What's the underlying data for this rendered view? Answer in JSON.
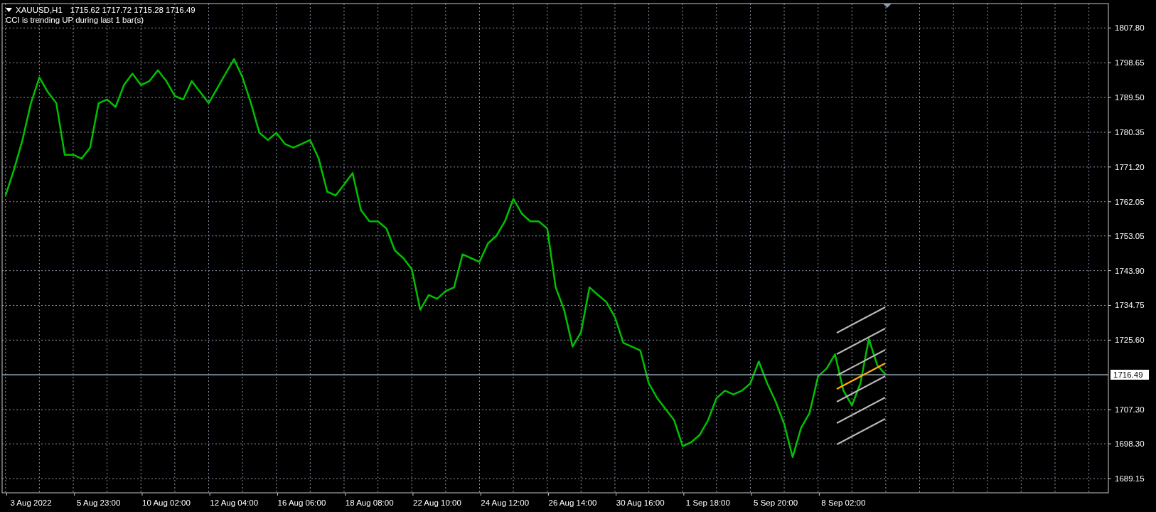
{
  "header": {
    "quotes": "1715.62 1717.72 1715.28 1716.49",
    "message": "CCI is trending UP during last 1 bar(s)"
  },
  "current_price": {
    "label": "1716.49"
  },
  "chart_data": {
    "type": "line",
    "grid": true,
    "ylim": [
      1685.4,
      1814.24
    ],
    "categories": [
      null,
      null,
      null,
      "3 Aug 2022",
      null,
      null,
      null,
      null,
      null,
      null,
      null,
      "5 Aug 23:00",
      null,
      null,
      null,
      null,
      null,
      null,
      null,
      "10 Aug 02:00",
      null,
      null,
      null,
      null,
      null,
      null,
      null,
      "12 Aug 04:00",
      null,
      null,
      null,
      null,
      null,
      null,
      null,
      "16 Aug 06:00",
      null,
      null,
      null,
      null,
      null,
      null,
      null,
      "18 Aug 08:00",
      null,
      null,
      null,
      null,
      null,
      null,
      null,
      "22 Aug 10:00",
      null,
      null,
      null,
      null,
      null,
      null,
      null,
      "24 Aug 12:00",
      null,
      null,
      null,
      null,
      null,
      null,
      null,
      "26 Aug 14:00",
      null,
      null,
      null,
      null,
      null,
      null,
      null,
      "30 Aug 16:00",
      null,
      null,
      null,
      null,
      null,
      null,
      null,
      "1 Sep 18:00",
      null,
      null,
      null,
      null,
      null,
      null,
      null,
      "5 Sep 20:00",
      null,
      null,
      null,
      null,
      null,
      null,
      null,
      "8 Sep 02:00",
      null,
      null,
      null,
      null,
      null
    ],
    "ref_lines": [
      {
        "axis": "y",
        "value": 1716.5
      }
    ],
    "yticks": [
      {
        "value": 1807.8,
        "label": "1807.80"
      },
      {
        "value": 1798.65,
        "label": "1798.65"
      },
      {
        "value": 1789.5,
        "label": "1789.50"
      },
      {
        "value": 1780.35,
        "label": "1780.35"
      },
      {
        "value": 1771.2,
        "label": "1771.20"
      },
      {
        "value": 1762.05,
        "label": "1762.05"
      },
      {
        "value": 1753.05,
        "label": "1753.05"
      },
      {
        "value": 1743.9,
        "label": "1743.90"
      },
      {
        "value": 1734.75,
        "label": "1734.75"
      },
      {
        "value": 1725.6,
        "label": "1725.60"
      },
      {
        "value": 1707.3,
        "label": "1707.30"
      },
      {
        "value": 1698.3,
        "label": "1698.30"
      },
      {
        "value": 1689.15,
        "label": "1689.15"
      }
    ],
    "series": [
      {
        "name": "XAUUSD,H1",
        "color": "#00c000",
        "values": [
          1763.7,
          1770.5,
          1778.3,
          1788,
          1794.8,
          1790.9,
          1788,
          1774.4,
          1774.4,
          1773.4,
          1776.3,
          1788,
          1789,
          1787,
          1792.8,
          1795.8,
          1792.8,
          1793.8,
          1796.7,
          1793.8,
          1789.9,
          1789,
          1793.8,
          1790.9,
          1788,
          1791.9,
          1795.8,
          1799.6,
          1794.8,
          1788,
          1780.2,
          1778.3,
          1780.2,
          1777.3,
          1776.3,
          1777.3,
          1778.3,
          1773.4,
          1764.7,
          1763.7,
          1766.6,
          1769.6,
          1759.8,
          1756.9,
          1756.9,
          1755,
          1749.2,
          1747.2,
          1744.3,
          1733.6,
          1737.5,
          1736.5,
          1738.5,
          1739.5,
          1748.2,
          1747.2,
          1746.2,
          1751.1,
          1753.1,
          1756.9,
          1762.8,
          1758.9,
          1756.9,
          1756.9,
          1755,
          1739.5,
          1733.6,
          1723.9,
          1727.7,
          1739.5,
          1737.5,
          1735.6,
          1731.7,
          1724.9,
          1723.9,
          1722.9,
          1714.2,
          1710.3,
          1707.4,
          1704.5,
          1697.7,
          1698.7,
          1700.6,
          1704.5,
          1710.3,
          1712.3,
          1711.3,
          1712.3,
          1714.2,
          1720,
          1714.2,
          1709.4,
          1703.5,
          1694.8,
          1702.5,
          1706.4,
          1716.1,
          1718.1,
          1721.9,
          1712.3,
          1708.4,
          1714.2,
          1725.9,
          1719,
          1716.5
        ]
      }
    ]
  }
}
